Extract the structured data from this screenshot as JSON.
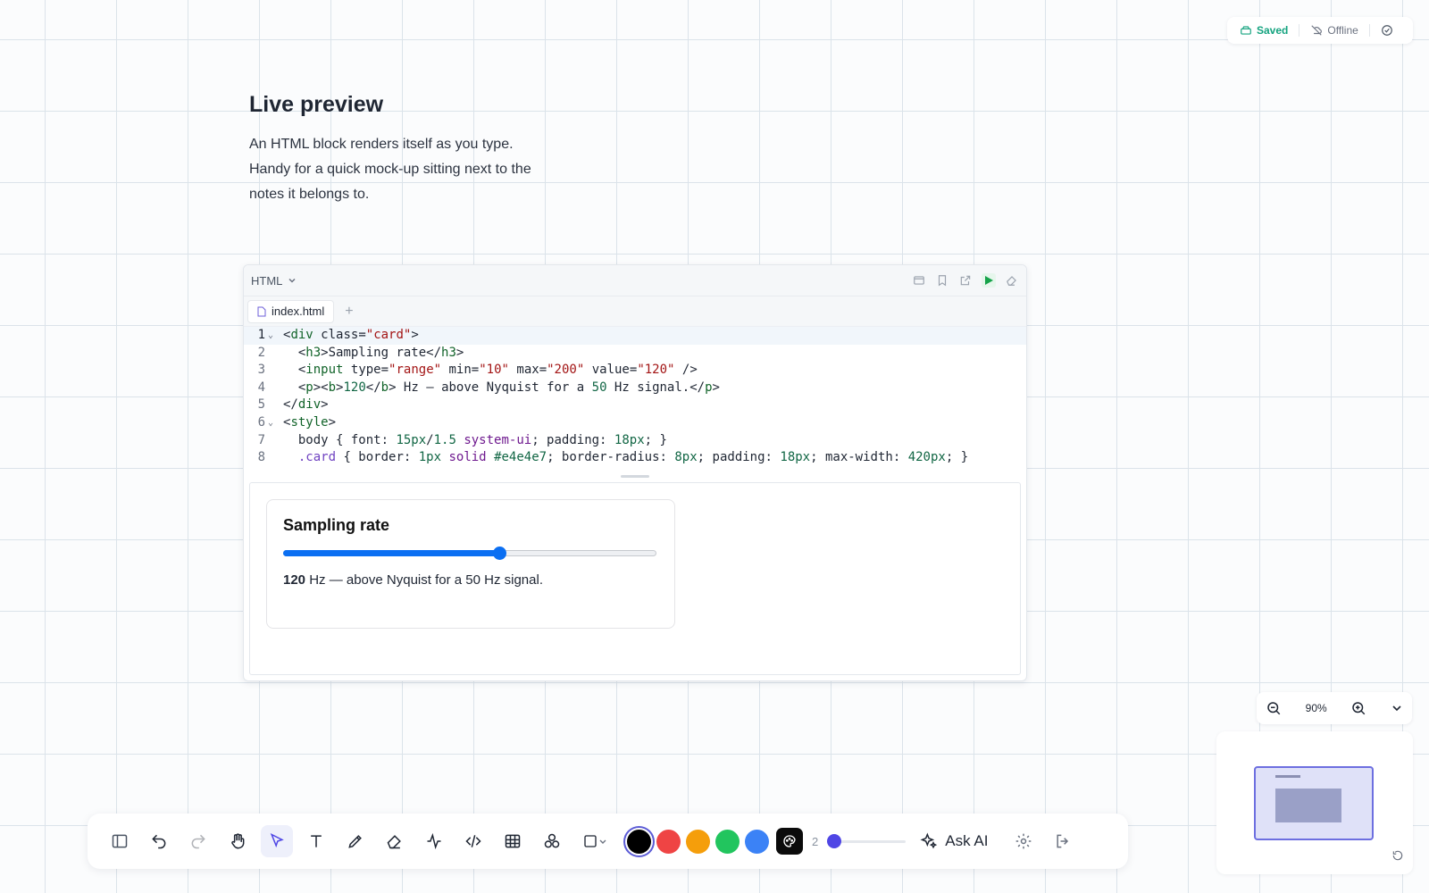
{
  "status": {
    "saved_label": "Saved",
    "offline_label": "Offline"
  },
  "note": {
    "title": "Live preview",
    "description": "An HTML block renders itself as you type. Handy for a quick mock-up sitting next to the notes it belongs to."
  },
  "code_block": {
    "language": "HTML",
    "file_tab": "index.html",
    "add_tab": "+",
    "lines": [
      {
        "n": "1",
        "fold": "⌄"
      },
      {
        "n": "2",
        "fold": ""
      },
      {
        "n": "3",
        "fold": ""
      },
      {
        "n": "4",
        "fold": ""
      },
      {
        "n": "5",
        "fold": ""
      },
      {
        "n": "6",
        "fold": "⌄"
      },
      {
        "n": "7",
        "fold": ""
      },
      {
        "n": "8",
        "fold": ""
      }
    ],
    "code_text": [
      "<div class=\"card\">",
      "  <h3>Sampling rate</h3>",
      "  <input type=\"range\" min=\"10\" max=\"200\" value=\"120\" />",
      "  <p><b>120</b> Hz — above Nyquist for a 50 Hz signal.</p>",
      "</div>",
      "<style>",
      "  body { font: 15px/1.5 system-ui; padding: 18px; }",
      "  .card { border: 1px solid #e4e4e7; border-radius: 8px; padding: 18px; max-width: 420px; }"
    ]
  },
  "preview": {
    "card_title": "Sampling rate",
    "slider_min": 10,
    "slider_max": 200,
    "slider_value": 120,
    "value_bold": "120",
    "value_rest": " Hz — above Nyquist for a 50 Hz signal."
  },
  "zoom": {
    "level": "90%"
  },
  "toolbar": {
    "stroke_count": "2",
    "ask_ai_label": "Ask AI",
    "colors": [
      "#000000",
      "#ef4444",
      "#f59e0b",
      "#22c55e",
      "#3b82f6"
    ],
    "selected_color": "#000000"
  }
}
